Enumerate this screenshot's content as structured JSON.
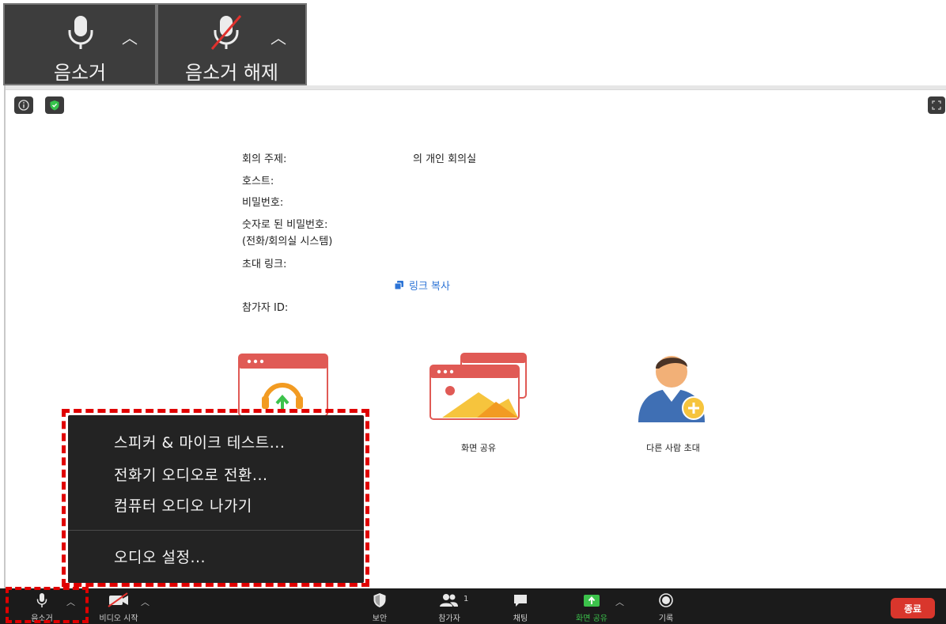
{
  "callouts": {
    "mute_label": "음소거",
    "unmute_label": "음소거 해제"
  },
  "meeting_info": {
    "topic_label": "회의 주제:",
    "topic_value": "의 개인 회의실",
    "host_label": "호스트:",
    "password_label": "비밀번호:",
    "numeric_password_label": "숫자로 된 비밀번호:",
    "numeric_password_sub": "(전화/회의실 시스템)",
    "invite_link_label": "초대 링크:",
    "copy_link": "링크 복사",
    "participant_id_label": "참가자 ID:"
  },
  "actions": {
    "share_screen": "화면 공유",
    "invite_others": "다른 사람 초대"
  },
  "audio_menu": {
    "items": [
      "스피커 & 마이크 테스트...",
      "전화기 오디오로 전환...",
      "컴퓨터 오디오 나가기",
      "오디오 설정..."
    ]
  },
  "toolbar": {
    "mute": "음소거",
    "start_video": "비디오 시작",
    "security": "보안",
    "participants": "참가자",
    "participants_count": "1",
    "chat": "채팅",
    "share_screen": "화면 공유",
    "record": "기록",
    "end": "종료"
  },
  "colors": {
    "highlight": "#e00000",
    "share_green": "#3cc24b",
    "end_red": "#d9362c",
    "link_blue": "#2d74d6"
  }
}
